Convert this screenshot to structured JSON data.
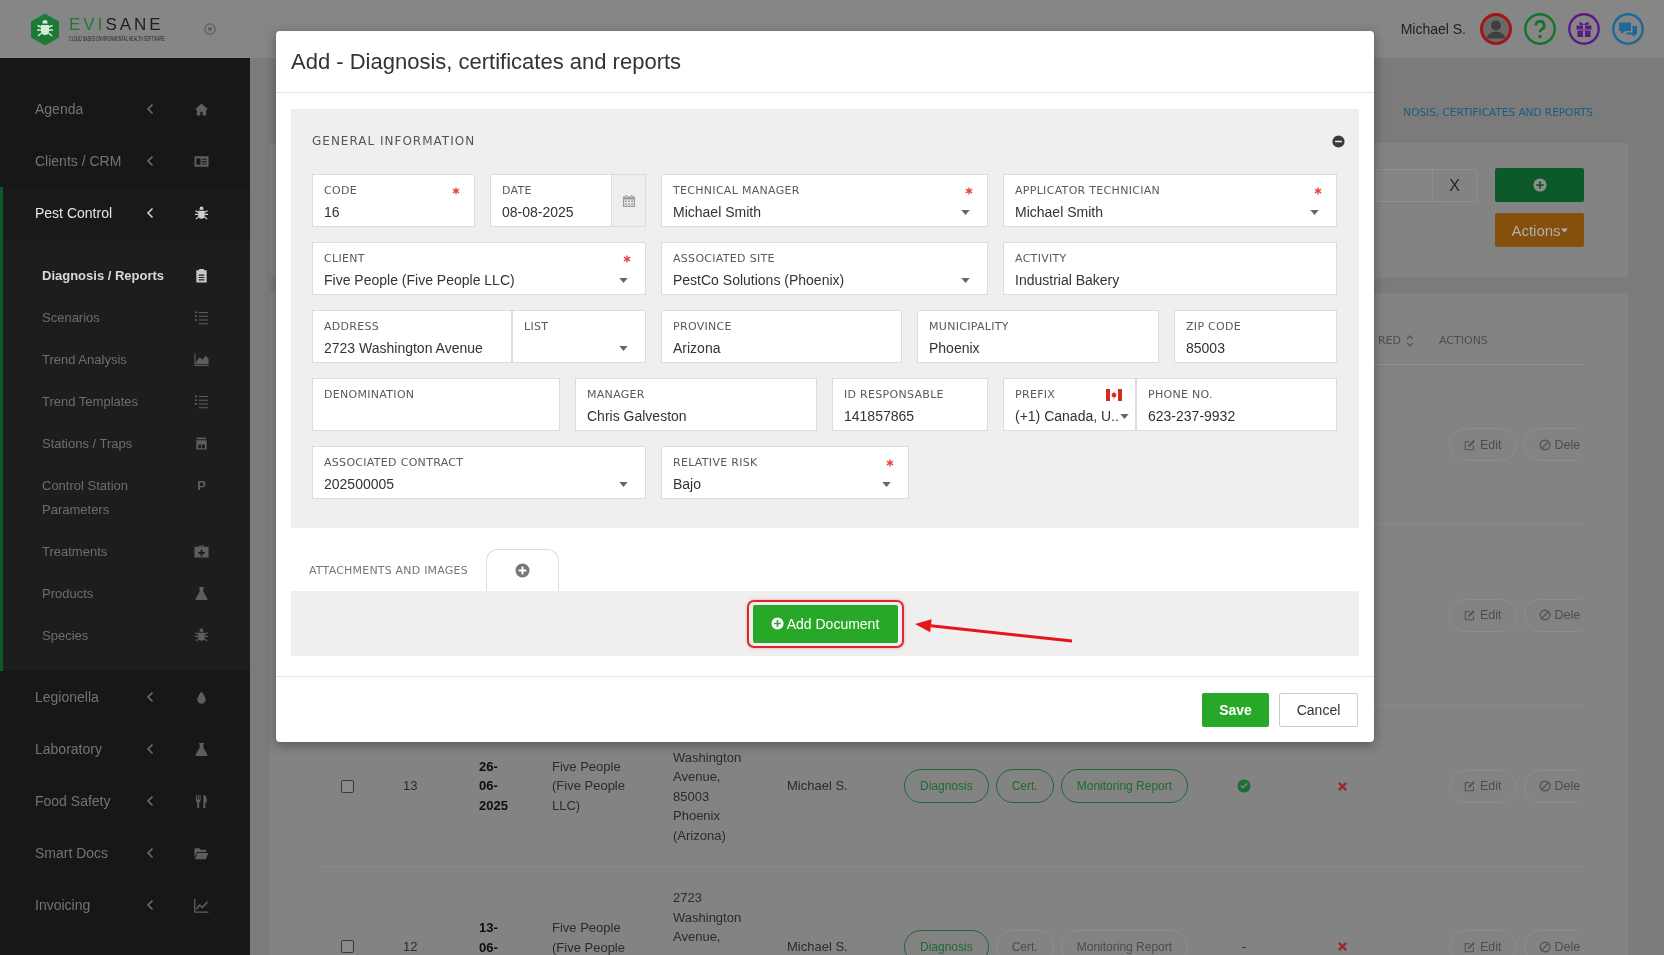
{
  "header": {
    "brand": "EVISANE",
    "tagline": "CLOUD BASED ENVIRONMENTAL HEALTH SOFTWARE",
    "user_name": "Michael S."
  },
  "sidebar": {
    "items": [
      {
        "label": "Agenda",
        "expanded": false
      },
      {
        "label": "Clients / CRM",
        "expanded": false
      },
      {
        "label": "Pest Control",
        "expanded": true,
        "children": [
          {
            "label": "Diagnosis / Reports",
            "selected": true
          },
          {
            "label": "Scenarios",
            "selected": false
          },
          {
            "label": "Trend Analysis",
            "selected": false
          },
          {
            "label": "Trend Templates",
            "selected": false
          },
          {
            "label": "Stations / Traps",
            "selected": false
          },
          {
            "label": "Control Station Parameters",
            "selected": false,
            "icon_letter": "P"
          },
          {
            "label": "Treatments",
            "selected": false
          },
          {
            "label": "Products",
            "selected": false
          },
          {
            "label": "Species",
            "selected": false
          }
        ]
      },
      {
        "label": "Legionella",
        "expanded": false
      },
      {
        "label": "Laboratory",
        "expanded": false
      },
      {
        "label": "Food Safety",
        "expanded": false
      },
      {
        "label": "Smart Docs",
        "expanded": false
      },
      {
        "label": "Invoicing",
        "expanded": false
      }
    ]
  },
  "page": {
    "breadcrumb": "NOSIS, CERTIFICATES AND REPORTS",
    "toolbar": {
      "clear_label": "X",
      "actions_label": "Actions"
    },
    "table": {
      "columns": [
        {
          "label": "RED",
          "sortable": true
        },
        {
          "label": "ACTIONS",
          "sortable": false
        }
      ],
      "rows": [
        {
          "actions": [
            "Edit",
            "Dele"
          ]
        },
        {
          "actions": [
            "Edit",
            "Dele"
          ]
        },
        {
          "checked": false,
          "code": "13",
          "date": "26-06-2025",
          "client": "Five People (Five People LLC)",
          "address": "Washington Avenue, 85003 Phoenix (Arizona)",
          "manager": "Michael S.",
          "documents": [
            {
              "label": "Diagnosis",
              "available": true
            },
            {
              "label": "Cert.",
              "available": true
            },
            {
              "label": "Monitoring Report",
              "available": true
            }
          ],
          "column_8": {
            "kind": "check"
          },
          "column_9": {
            "kind": "cross"
          },
          "actions": [
            "Edit",
            "Dele"
          ]
        },
        {
          "checked": false,
          "code": "12",
          "date": "13-06-",
          "client": "Five People (Five People",
          "address": "2723 Washington Avenue,",
          "manager": "Michael S.",
          "documents": [
            {
              "label": "Diagnosis",
              "available": true
            },
            {
              "label": "Cert.",
              "available": false
            },
            {
              "label": "Monitoring Report",
              "available": false
            }
          ],
          "column_8": {
            "kind": "text",
            "text": "-"
          },
          "column_9": {
            "kind": "cross"
          },
          "actions": [
            "Edit",
            "Dele"
          ]
        }
      ]
    }
  },
  "modal": {
    "title": "Add - Diagnosis, certificates and reports",
    "general_information": {
      "title": "GENERAL INFORMATION",
      "rows": [
        {
          "fields": [
            {
              "kind": "text",
              "label": "CODE",
              "value": "16",
              "required": true
            },
            {
              "kind": "date",
              "label": "DATE",
              "value": "08-08-2025",
              "required": false
            },
            {
              "kind": "select",
              "label": "TECHNICAL MANAGER",
              "value": "Michael Smith",
              "required": true
            },
            {
              "kind": "select",
              "label": "APPLICATOR TECHNICIAN",
              "value": "Michael Smith",
              "required": true
            }
          ]
        },
        {
          "fields": [
            {
              "kind": "select",
              "label": "CLIENT",
              "value": "Five People (Five People LLC)",
              "required": true
            },
            {
              "kind": "select",
              "label": "ASSOCIATED SITE",
              "value": "PestCo Solutions (Phoenix)",
              "required": false
            },
            {
              "kind": "text",
              "label": "ACTIVITY",
              "value": "Industrial Bakery",
              "required": false
            }
          ]
        },
        {
          "fields": [
            {
              "kind": "text",
              "label": "ADDRESS",
              "value": "2723 Washington Avenue",
              "required": false
            },
            {
              "kind": "select",
              "label": "LIST",
              "required": false
            },
            {
              "kind": "text",
              "label": "PROVINCE",
              "value": "Arizona",
              "required": false
            },
            {
              "kind": "text",
              "label": "MUNICIPALITY",
              "value": "Phoenix",
              "required": false
            },
            {
              "kind": "text",
              "label": "ZIP CODE",
              "value": "85003",
              "required": false
            }
          ]
        },
        {
          "fields": [
            {
              "kind": "text",
              "label": "DENOMINATION",
              "required": false
            },
            {
              "kind": "text",
              "label": "MANAGER",
              "value": "Chris Galveston",
              "required": false
            },
            {
              "kind": "text",
              "label": "ID RESPONSABLE",
              "value": "141857865",
              "required": false
            },
            {
              "kind": "phone_prefix",
              "label": "PREFIX",
              "value": "(+1) Canada, U..",
              "required": false
            },
            {
              "kind": "text",
              "label": "PHONE NO.",
              "value": "623-237-9932",
              "required": false
            }
          ]
        },
        {
          "fields": [
            {
              "kind": "select",
              "label": "ASSOCIATED CONTRACT",
              "value": "202500005",
              "required": false
            },
            {
              "kind": "select",
              "label": "RELATIVE RISK",
              "value": "Bajo",
              "required": true
            }
          ]
        }
      ]
    },
    "attachments": {
      "tabs": [
        {
          "kind": "label",
          "label": "ATTACHMENTS AND IMAGES",
          "selected": false
        },
        {
          "kind": "add",
          "selected": true
        }
      ],
      "add_button": "Add Document"
    },
    "buttons": [
      {
        "kind": "primary",
        "label": "Save"
      },
      {
        "kind": "default",
        "label": "Cancel"
      }
    ]
  }
}
